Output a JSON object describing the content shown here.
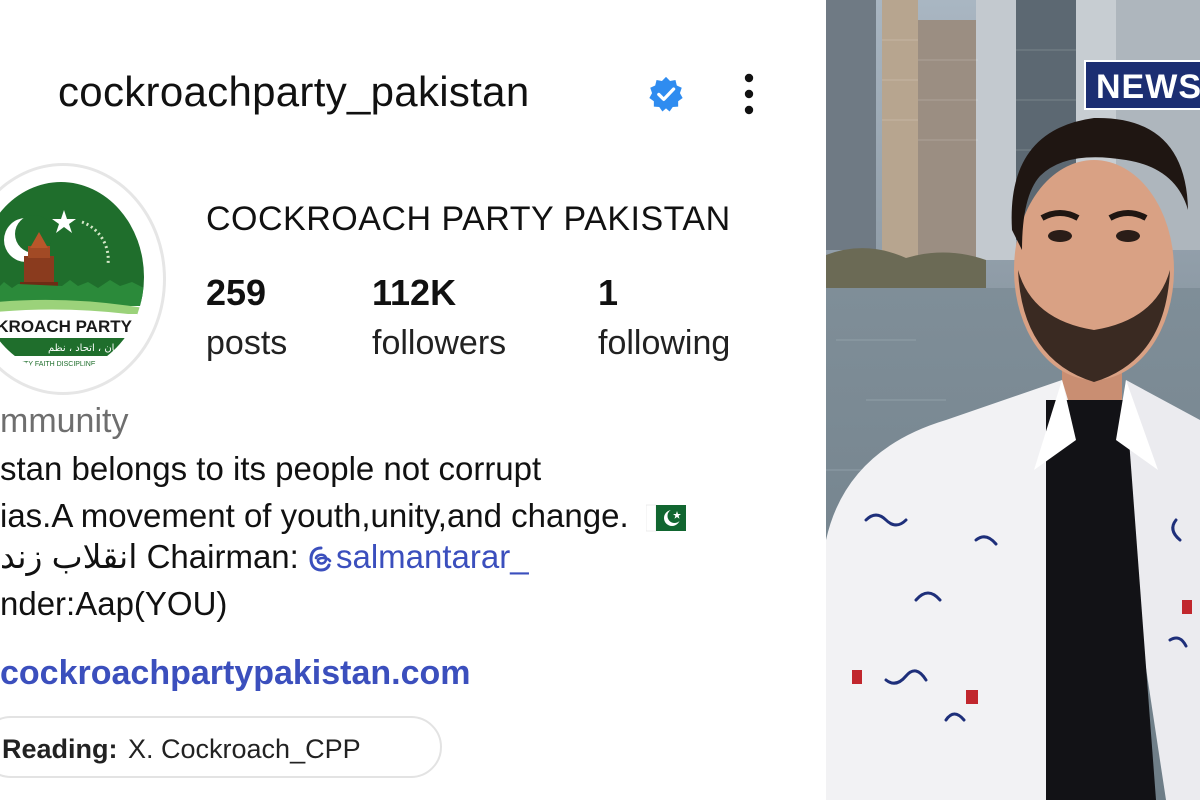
{
  "profile": {
    "username": "cockroachparty_pakistan",
    "display_name": "COCKROACH PARTY PAKISTAN",
    "verified": true,
    "icons": {
      "verified": "verified-badge-icon",
      "more": "more-options-icon",
      "flag": "pakistan-flag-icon",
      "mention": "threads-icon"
    },
    "stats": [
      {
        "value": "259",
        "label": "posts"
      },
      {
        "value": "112K",
        "label": "followers"
      },
      {
        "value": "1",
        "label": "following"
      }
    ],
    "category": "mmunity",
    "bio": {
      "line1": "stan belongs to its people not corrupt",
      "line2": "ias.A movement of youth,unity,and change.",
      "line3_prefix": "انقلاب زند Chairman: ",
      "line3_mention": "salmantarar_",
      "line4": "nder:Aap(YOU)"
    },
    "website": "cockroachpartypakistan.com",
    "chip": {
      "label": "Reading:",
      "value": "X.  Cockroach_CPP"
    },
    "logo_text": {
      "name": "CKROACH PARTY",
      "urdu": "ایمان ، اتحاد ، نظم",
      "motto": "UNITY FAITH DISCIPLINE"
    }
  },
  "photo": {
    "badge": "NEWS"
  },
  "colors": {
    "link": "#3b4fbd",
    "verified": "#2f8cf0",
    "badge_bg": "#1c2e72",
    "logo_green": "#1f6e2c"
  }
}
